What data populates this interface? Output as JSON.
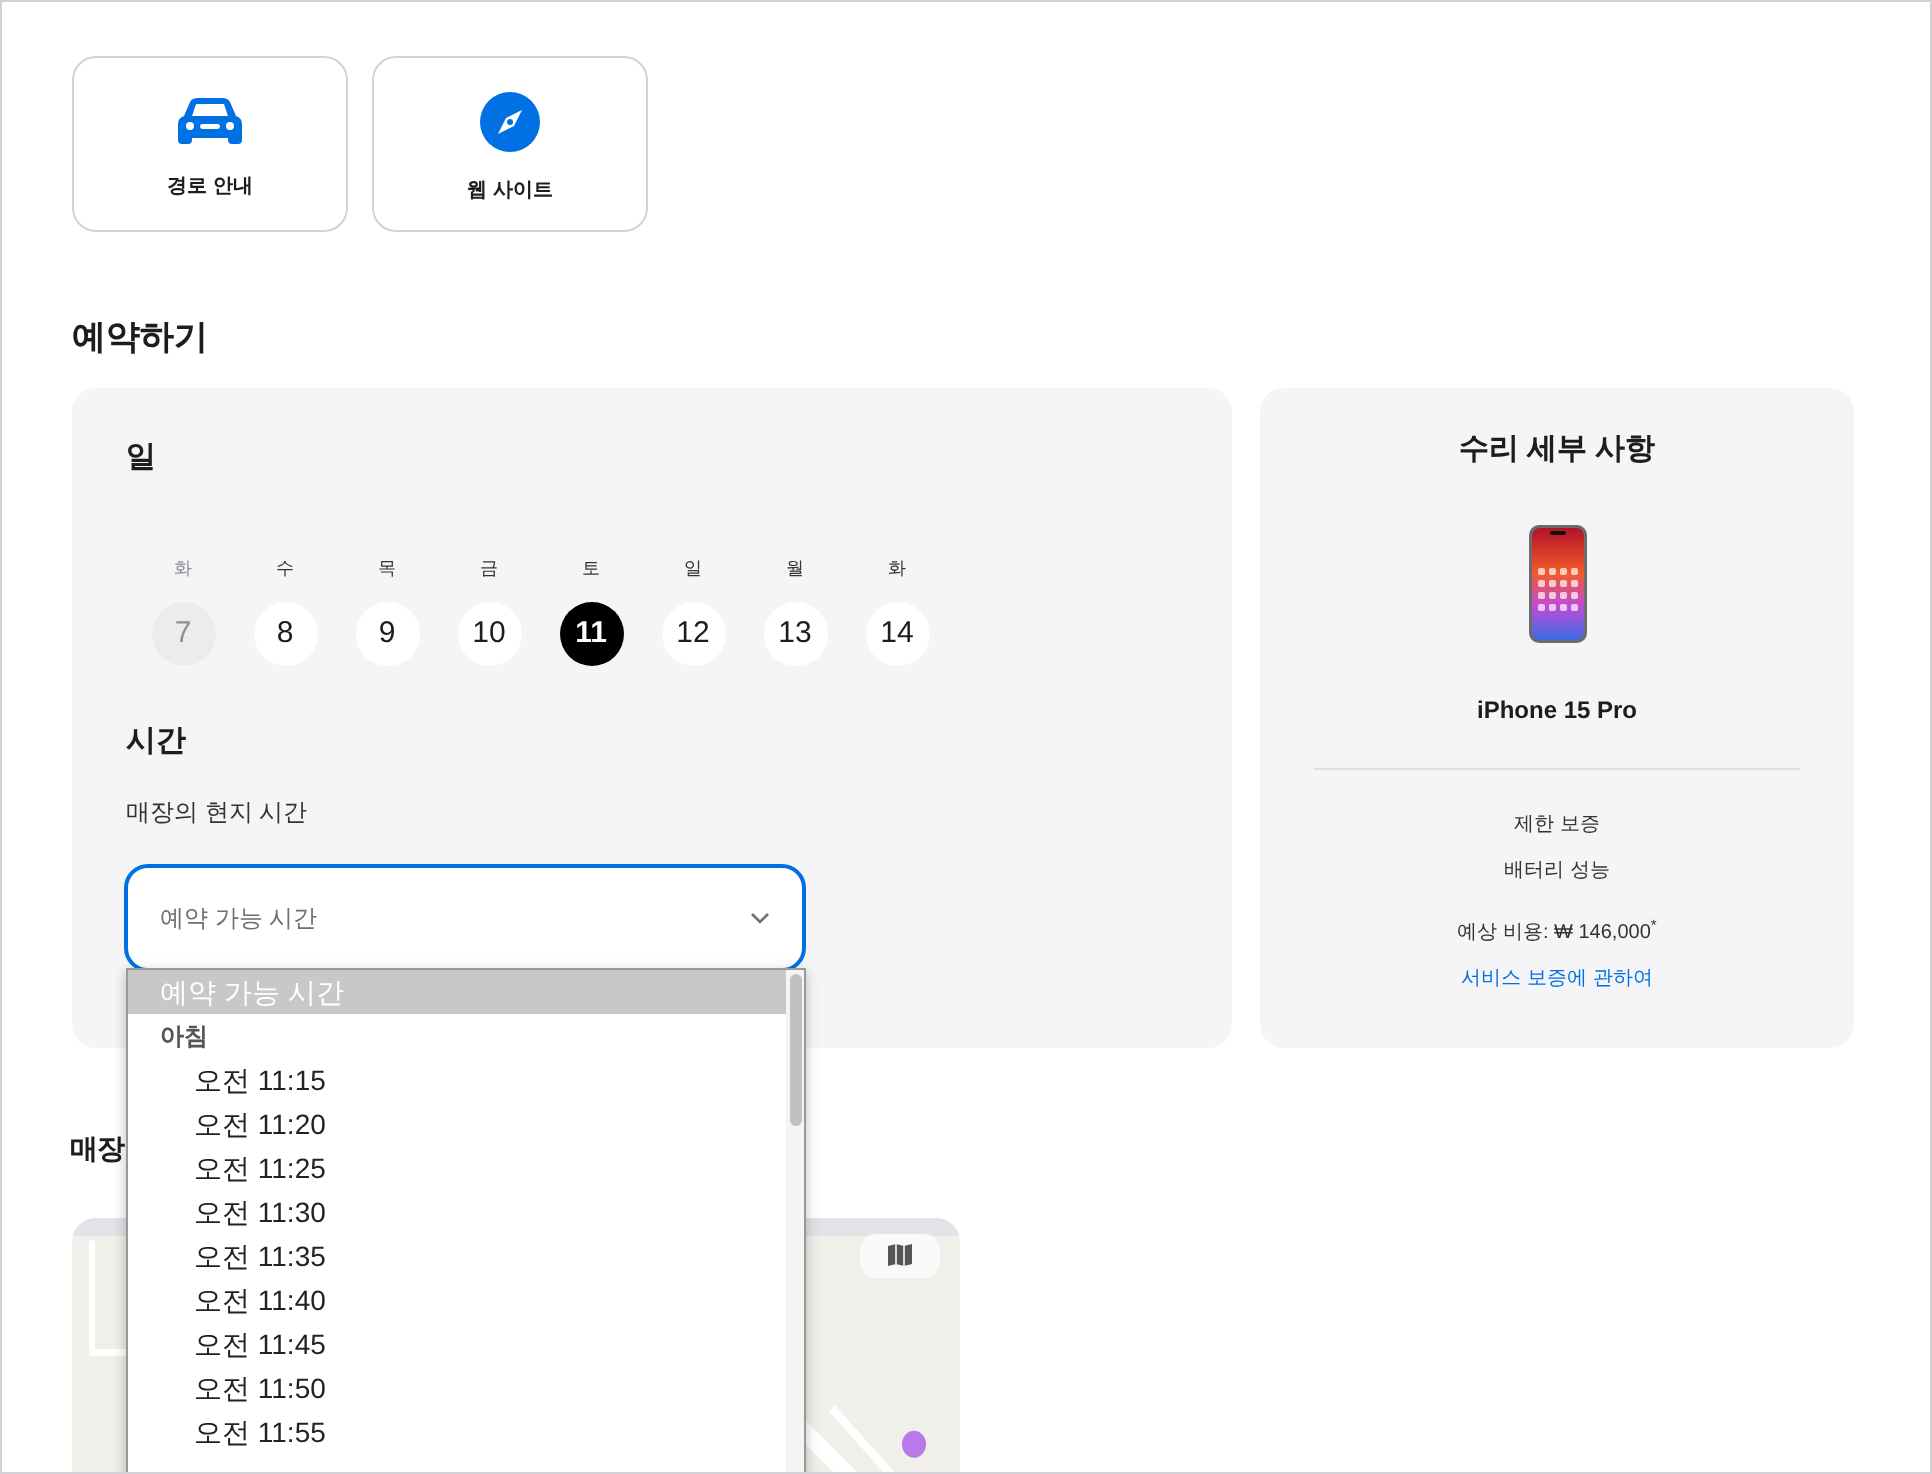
{
  "quick_actions": [
    {
      "kind": "car",
      "label": "경로 안내"
    },
    {
      "kind": "compass",
      "label": "웹 사이트"
    }
  ],
  "booking": {
    "title": "예약하기",
    "date": {
      "title": "일",
      "days": [
        {
          "weekday": "화",
          "day": "7",
          "disabled": true,
          "selected": false
        },
        {
          "weekday": "수",
          "day": "8",
          "disabled": false,
          "selected": false
        },
        {
          "weekday": "목",
          "day": "9",
          "disabled": false,
          "selected": false
        },
        {
          "weekday": "금",
          "day": "10",
          "disabled": false,
          "selected": false
        },
        {
          "weekday": "토",
          "day": "11",
          "disabled": false,
          "selected": true
        },
        {
          "weekday": "일",
          "day": "12",
          "disabled": false,
          "selected": false
        },
        {
          "weekday": "월",
          "day": "13",
          "disabled": false,
          "selected": false
        },
        {
          "weekday": "화",
          "day": "14",
          "disabled": false,
          "selected": false
        }
      ]
    },
    "time": {
      "title": "시간",
      "subtitle": "매장의 현지 시간",
      "select": {
        "placeholder": "예약 가능 시간",
        "expanded": true
      },
      "options": [
        {
          "kind": "option",
          "label": "예약 가능 시간",
          "selected": true
        },
        {
          "kind": "group",
          "label": "아침"
        },
        {
          "kind": "option",
          "label": "오전 11:15",
          "selected": false
        },
        {
          "kind": "option",
          "label": "오전 11:20",
          "selected": false
        },
        {
          "kind": "option",
          "label": "오전 11:25",
          "selected": false
        },
        {
          "kind": "option",
          "label": "오전 11:30",
          "selected": false
        },
        {
          "kind": "option",
          "label": "오전 11:35",
          "selected": false
        },
        {
          "kind": "option",
          "label": "오전 11:40",
          "selected": false
        },
        {
          "kind": "option",
          "label": "오전 11:45",
          "selected": false
        },
        {
          "kind": "option",
          "label": "오전 11:50",
          "selected": false
        },
        {
          "kind": "option",
          "label": "오전 11:55",
          "selected": false
        }
      ]
    }
  },
  "repair_details": {
    "title": "수리 세부 사항",
    "device": "iPhone 15 Pro",
    "items": [
      "제한 보증",
      "배터리 성능"
    ],
    "estimate": "예상 비용: ₩ 146,000",
    "estimate_note": "*",
    "link": "서비스 보증에 관하여"
  },
  "store_section": {
    "title": "매장"
  }
}
